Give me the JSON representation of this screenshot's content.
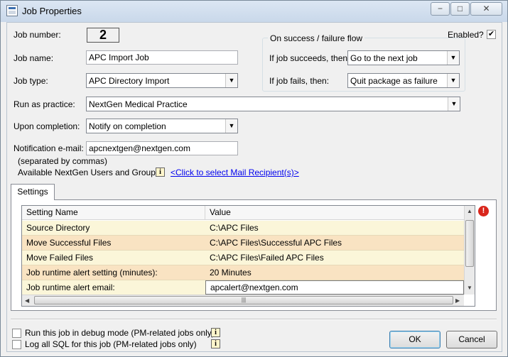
{
  "window": {
    "title": "Job Properties",
    "min_glyph": "−",
    "max_glyph": "□",
    "close_glyph": "✕"
  },
  "form": {
    "job_number_label": "Job number:",
    "job_number": "2",
    "job_name_label": "Job name:",
    "job_name": "APC Import Job",
    "job_type_label": "Job type:",
    "job_type": "APC Directory Import",
    "practice_label": "Run as practice:",
    "practice": "NextGen Medical Practice",
    "completion_label": "Upon completion:",
    "completion": "Notify on completion",
    "email_label": "Notification e-mail:",
    "email": "apcnextgen@nextgen.com",
    "email_hint": "(separated by commas)",
    "users_label": "Available NextGen Users and Groups:",
    "recipient_link": "<Click to select Mail Recipient(s)>"
  },
  "flow": {
    "title": "On success / failure flow",
    "enabled_label": "Enabled?",
    "enabled": true,
    "success_label": "If job succeeds, then:",
    "success_value": "Go to the next job",
    "fail_label": "If job fails, then:",
    "fail_value": "Quit package as failure"
  },
  "tabs": {
    "settings": "Settings"
  },
  "settings_grid": {
    "headers": [
      "Setting Name",
      "Value"
    ],
    "rows": [
      {
        "name": "Source Directory",
        "value": "C:\\APC Files"
      },
      {
        "name": "Move Successful Files",
        "value": "C:\\APC Files\\Successful APC Files"
      },
      {
        "name": "Move Failed Files",
        "value": "C:\\APC Files\\Failed APC Files"
      },
      {
        "name": "Job runtime alert setting (minutes):",
        "value": "20 Minutes"
      },
      {
        "name": "Job runtime alert email:",
        "value": "apcalert@nextgen.com"
      }
    ]
  },
  "options": {
    "debug_label": "Run this job in debug mode (PM-related jobs only)",
    "sql_label": "Log all SQL for this job (PM-related jobs only)"
  },
  "buttons": {
    "ok": "OK",
    "cancel": "Cancel"
  },
  "icons": {
    "info": "i",
    "warning": "!",
    "dropdown": "▼",
    "check": "✔"
  },
  "colors": {
    "row_odd": "#fbf6d9",
    "row_even": "#f9e3c2",
    "link": "#0000ee"
  }
}
